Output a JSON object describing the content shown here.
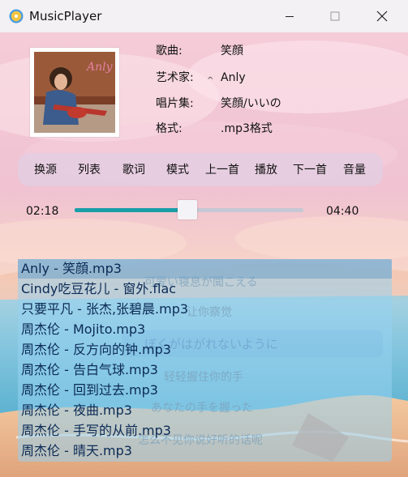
{
  "window": {
    "title": "MusicPlayer",
    "app_icon": "music-disc-icon",
    "minimize_icon": "minimize-icon",
    "maximize_icon": "maximize-icon",
    "close_icon": "close-icon"
  },
  "song_info": {
    "song_label": "歌曲:",
    "song_value": "笑顔",
    "artist_label": "艺术家:",
    "artist_value": "Anly",
    "album_label": "唱片集:",
    "album_value": "笑顔/いいの",
    "format_label": "格式:",
    "format_value": ".mp3格式",
    "album_art_text": "Anly"
  },
  "toolbar": {
    "buttons": [
      "换源",
      "列表",
      "歌词",
      "模式",
      "上一首",
      "播放",
      "下一首",
      "音量"
    ]
  },
  "progress": {
    "current": "02:18",
    "total": "04:40",
    "fraction": 0.493,
    "accent": "#1a9ea8"
  },
  "lyrics": {
    "lines": [
      "可爱い寝息が聞こえる",
      "让你察觉",
      "",
      "轻轻握住你的手",
      "あなたの手を握った",
      "怎么不见你说好听的话呢"
    ],
    "current_line": "ぼくがはがれないように"
  },
  "playlist": {
    "selected_index": 0,
    "items": [
      "Anly - 笑顔.mp3",
      "Cindy吃豆花儿 - 窗外.flac",
      "只要平凡 - 张杰,张碧晨.mp3",
      "周杰伦 - Mojito.mp3",
      "周杰伦 - 反方向的钟.mp3",
      "周杰伦 - 告白气球.mp3",
      "周杰伦 - 回到过去.mp3",
      "周杰伦 - 夜曲.mp3",
      "周杰伦 - 手写的从前.mp3",
      "周杰伦 - 晴天.mp3"
    ]
  }
}
